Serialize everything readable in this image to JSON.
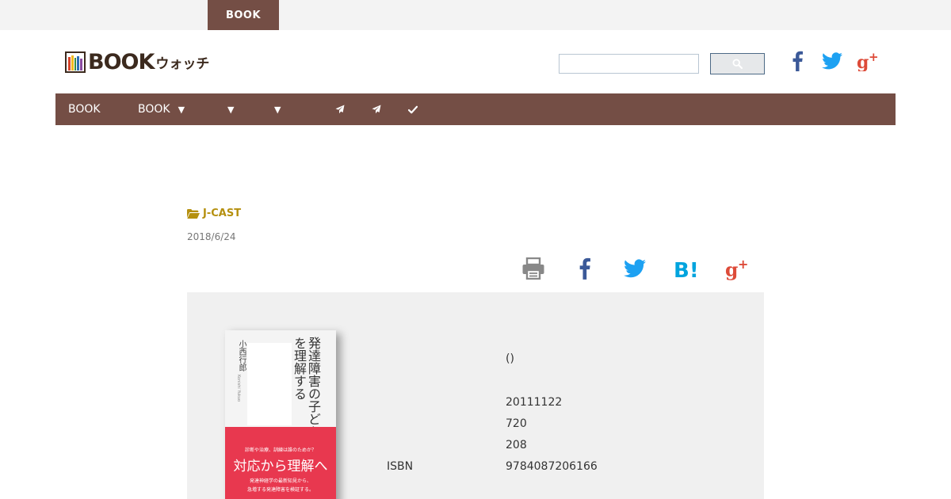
{
  "top": {
    "tab_label": "BOOK"
  },
  "logo": {
    "text": "BOOK",
    "sub": "ウォッチ"
  },
  "nav": {
    "book_label": "BOOK",
    "book_dropdown_label": "BOOK",
    "arrow": "▼"
  },
  "article": {
    "category": "J-CAST",
    "date": "2018/6/24"
  },
  "book": {
    "cover_title": "発達障害の子どもを理解する",
    "cover_author": "小西行郎",
    "cover_author_en": "Konishi Yukuo",
    "cover_question": "診断や治療、訓練は誰のためか？",
    "cover_main": "対応から理解へ",
    "cover_sub_1": "発達神経学の最新知見から、",
    "cover_sub_2": "急増する発達障害を検証する。",
    "publisher_value": "()",
    "date_value": "20111122",
    "price_value": "720",
    "pages_value": "208",
    "isbn_label": "ISBN",
    "isbn_value": "9784087206166"
  },
  "colors": {
    "brand_brown": "#744e45",
    "category_gold": "#b5900f",
    "facebook_blue": "#3b5998",
    "twitter_blue": "#1da1f2",
    "google_red": "#dd4b39",
    "hatena_blue": "#00a4de"
  }
}
